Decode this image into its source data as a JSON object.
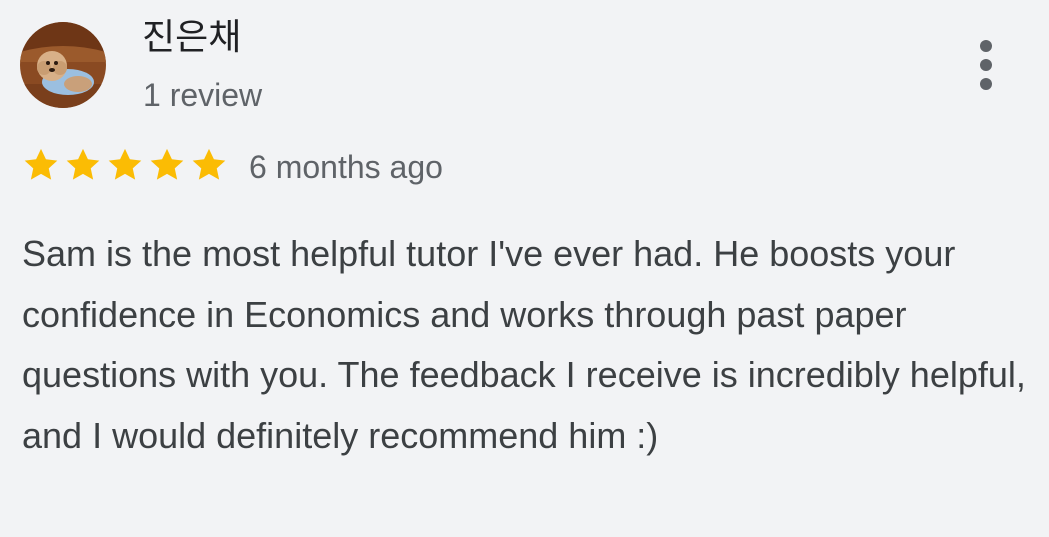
{
  "reviewer": {
    "name": "진은채",
    "review_count": "1 review",
    "avatar_icon": "dog-avatar-icon"
  },
  "menu": {
    "icon": "more-vert-icon"
  },
  "rating": {
    "stars": 5,
    "max_stars": 5,
    "color": "#fbbc04",
    "time": "6 months ago"
  },
  "review": {
    "text": "Sam is the most helpful tutor I've ever had. He boosts your confidence in Economics and works through past paper questions with you. The feedback I receive is incredibly helpful, and I would definitely recommend him :)"
  },
  "colors": {
    "background": "#f2f3f5",
    "text_primary": "#202124",
    "text_secondary": "#5f6368"
  }
}
